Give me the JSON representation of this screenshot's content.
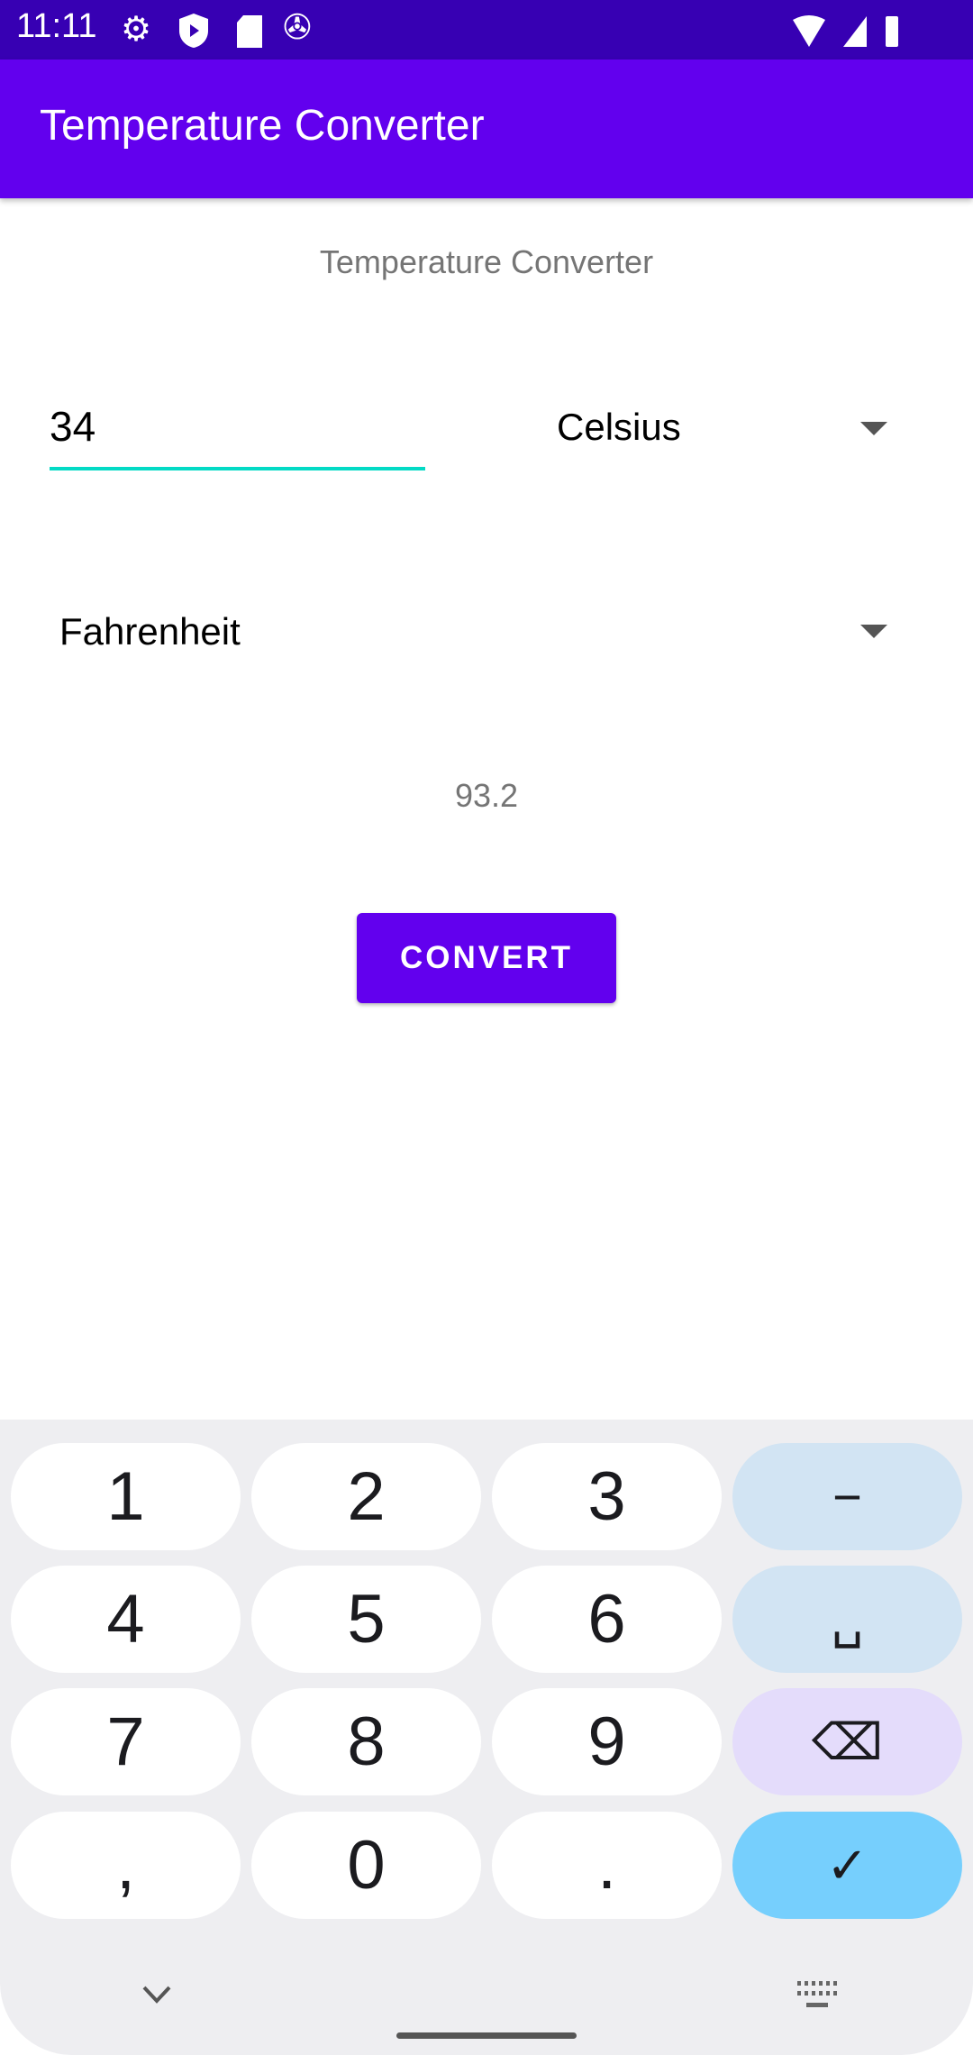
{
  "status_bar": {
    "time": "11:11"
  },
  "app_bar": {
    "title": "Temperature Converter"
  },
  "main": {
    "heading": "Temperature Converter",
    "input_value": "34",
    "from_unit": "Celsius",
    "to_unit": "Fahrenheit",
    "result": "93.2",
    "convert_label": "CONVERT"
  },
  "keyboard": {
    "keys": [
      "1",
      "2",
      "3",
      "−",
      "4",
      "5",
      "6",
      "␣",
      "7",
      "8",
      "9",
      "⌫",
      ",",
      "0",
      ".",
      "✓"
    ]
  },
  "colors": {
    "primary": "#6200ee",
    "primary_dark": "#3700b3",
    "accent": "#03dac5"
  }
}
